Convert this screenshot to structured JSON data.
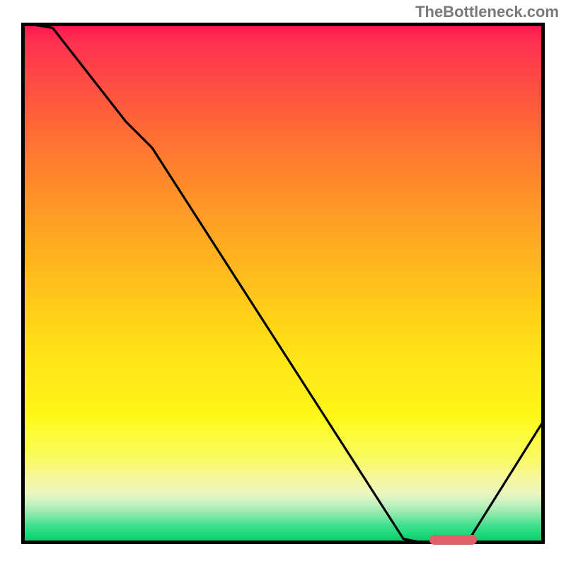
{
  "watermark": "TheBottleneck.com",
  "chart_data": {
    "type": "line",
    "title": "",
    "xlabel": "",
    "ylabel": "",
    "xlim": [
      0,
      100
    ],
    "ylim": [
      0,
      100
    ],
    "series": [
      {
        "name": "bottleneck-curve",
        "x": [
          0,
          6,
          20,
          25,
          73,
          78,
          85,
          100
        ],
        "y": [
          100,
          99,
          81,
          76,
          1,
          0,
          0,
          24
        ]
      }
    ],
    "marker": {
      "x_start": 78,
      "x_end": 87,
      "y": 0.8
    },
    "gradient_stops": [
      {
        "pct": 0,
        "color": "#ff1850"
      },
      {
        "pct": 12,
        "color": "#ff5042"
      },
      {
        "pct": 32,
        "color": "#ff8f2a"
      },
      {
        "pct": 56,
        "color": "#ffd018"
      },
      {
        "pct": 76,
        "color": "#fff818"
      },
      {
        "pct": 91,
        "color": "#e8f6c0"
      },
      {
        "pct": 97,
        "color": "#40e090"
      },
      {
        "pct": 100,
        "color": "#10c86a"
      }
    ]
  }
}
